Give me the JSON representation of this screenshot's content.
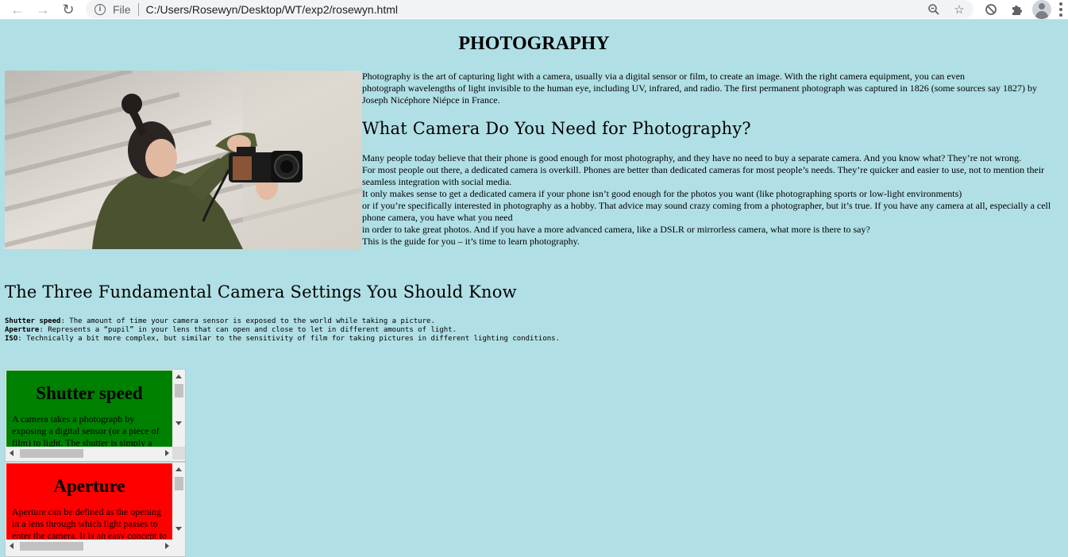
{
  "browser": {
    "back_icon": "arrow-left-icon",
    "forward_icon": "arrow-right-icon",
    "reload_icon": "reload-icon",
    "site_info_icon": "info-icon",
    "scheme_label": "File",
    "url": "C:/Users/Rosewyn/Desktop/WT/exp2/rosewyn.html",
    "toolbar_icons": [
      "zoom-icon",
      "bookmark-star-icon",
      "block-icon",
      "extensions-puzzle-icon",
      "profile-avatar-icon",
      "menu-dots-icon"
    ]
  },
  "page": {
    "title": "PHOTOGRAPHY",
    "intro_line1": "Photography is the art of capturing light with a camera, usually via a digital sensor or film, to create an image. With the right camera equipment, you can even",
    "intro_line2": "photograph wavelengths of light invisible to the human eye, including UV, infrared, and radio. The first permanent photograph was captured in 1826 (some sources say 1827) by Joseph Nicéphore Niépce in France.",
    "camera_heading": "What Camera Do You Need for Photography?",
    "camera_paragraphs": [
      "Many people today believe that their phone is good enough for most photography, and they have no need to buy a separate camera. And you know what? They’re not wrong.",
      "For most people out there, a dedicated camera is overkill. Phones are better than dedicated cameras for most people’s needs. They’re quicker and easier to use, not to mention their seamless integration with social media.",
      "It only makes sense to get a dedicated camera if your phone isn’t good enough for the photos you want (like photographing sports or low-light environments)",
      "or if you’re specifically interested in photography as a hobby. That advice may sound crazy coming from a photographer, but it’s true. If you have any camera at all, especially a cell phone camera, you have what you need",
      "in order to take great photos. And if you have a more advanced camera, like a DSLR or mirrorless camera, what more is there to say?",
      "This is the guide for you – it’s time to learn photography."
    ],
    "settings_heading": "The Three Fundamental Camera Settings You Should Know",
    "settings": [
      {
        "term": "Shutter speed",
        "desc": ": The amount of time your camera sensor is exposed to the world while taking a picture."
      },
      {
        "term": "Aperture",
        "desc": ": Represents a “pupil” in your lens that can open and close to let in different amounts of light."
      },
      {
        "term": "ISO",
        "desc": ": Technically a bit more complex, but similar to the sensitivity of film for taking pictures in different lighting conditions."
      }
    ],
    "boxes": [
      {
        "title": "Shutter speed",
        "text": "A camera takes a photograph by exposing a digital sensor (or a piece of film) to light. The shutter is simply a",
        "color": "#008000"
      },
      {
        "title": "Aperture",
        "text": "Aperture can be defined as the opening in a lens through which light passes to enter the camera. It is an easy concept to",
        "color": "#ff0000"
      }
    ]
  }
}
